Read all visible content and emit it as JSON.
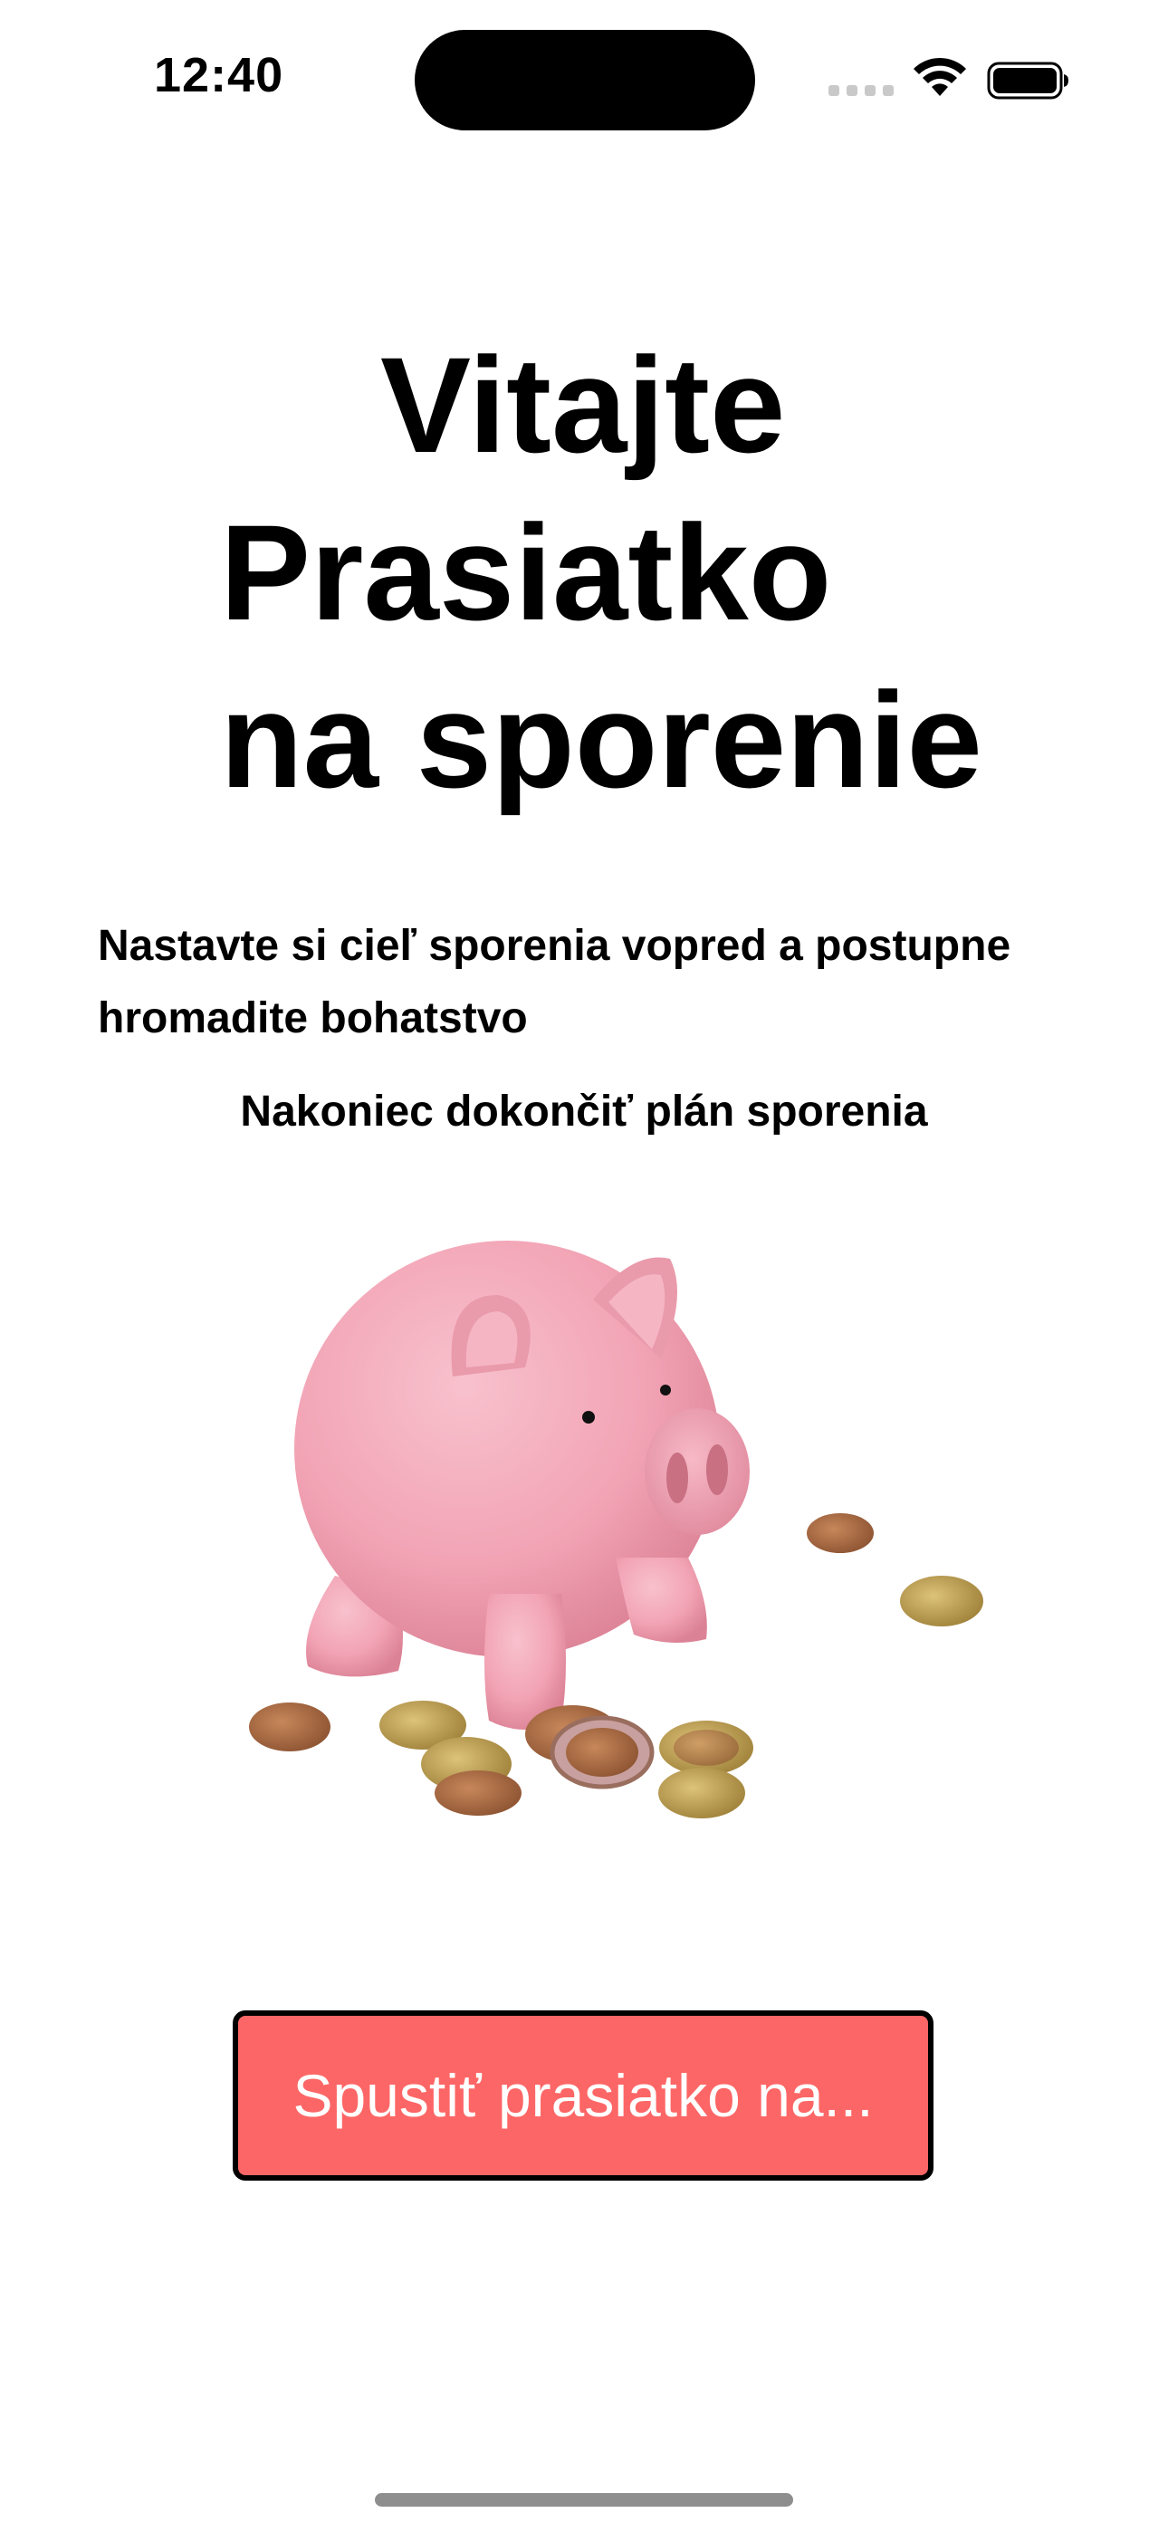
{
  "status_bar": {
    "time": "12:40"
  },
  "welcome": {
    "title_line1": "Vitajte",
    "title_line2": "Prasiatko",
    "title_line3": "na sporenie",
    "description": "Nastavte si cieľ sporenia vopred a postupne hromadite bohatstvo",
    "subtitle": "Nakoniec dokončiť plán sporenia"
  },
  "illustration": {
    "icon": "piggy-bank-with-coins"
  },
  "actions": {
    "start_label": "Spustiť prasiatko na..."
  },
  "colors": {
    "button_bg": "#fd6666",
    "button_border": "#000000",
    "button_text": "#ffffff",
    "pig_pink": "#f4a5b6"
  }
}
